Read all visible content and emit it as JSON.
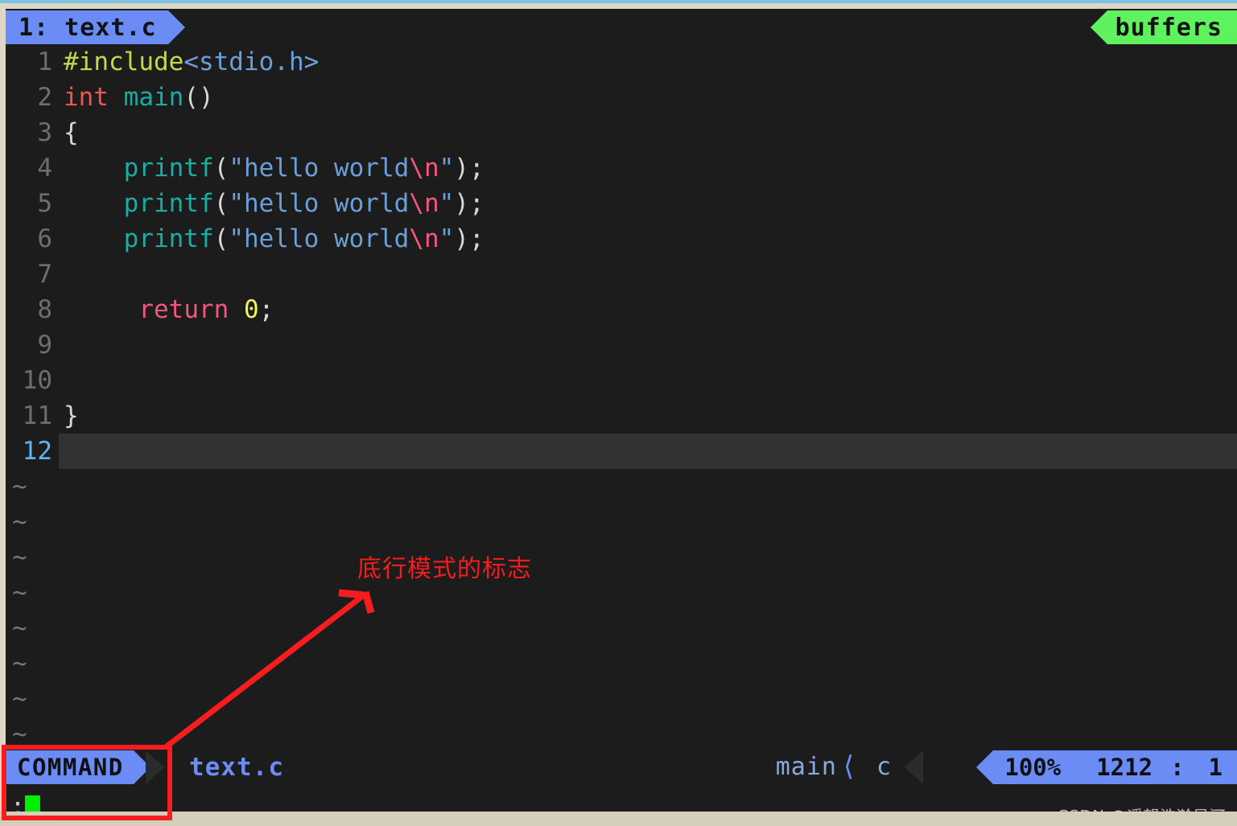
{
  "window": {
    "tabline": {
      "active_tab": "1: text.c",
      "buffers_label": "buffers"
    }
  },
  "editor": {
    "lines": [
      {
        "num": "1",
        "segments": [
          {
            "t": "#include",
            "c": "c-pre"
          },
          {
            "t": "<stdio.h>",
            "c": "c-hdr"
          }
        ]
      },
      {
        "num": "2",
        "segments": [
          {
            "t": "int ",
            "c": "c-type"
          },
          {
            "t": "main",
            "c": "c-fn"
          },
          {
            "t": "()",
            "c": "c-punc"
          }
        ]
      },
      {
        "num": "3",
        "segments": [
          {
            "t": "{",
            "c": "c-plain"
          }
        ]
      },
      {
        "num": "4",
        "segments": [
          {
            "t": "    ",
            "c": "c-plain"
          },
          {
            "t": "printf",
            "c": "c-fn"
          },
          {
            "t": "(",
            "c": "c-punc"
          },
          {
            "t": "\"hello world",
            "c": "c-str"
          },
          {
            "t": "\\n",
            "c": "c-esc"
          },
          {
            "t": "\"",
            "c": "c-str"
          },
          {
            "t": ");",
            "c": "c-punc"
          }
        ]
      },
      {
        "num": "5",
        "segments": [
          {
            "t": "    ",
            "c": "c-plain"
          },
          {
            "t": "printf",
            "c": "c-fn"
          },
          {
            "t": "(",
            "c": "c-punc"
          },
          {
            "t": "\"hello world",
            "c": "c-str"
          },
          {
            "t": "\\n",
            "c": "c-esc"
          },
          {
            "t": "\"",
            "c": "c-str"
          },
          {
            "t": ");",
            "c": "c-punc"
          }
        ]
      },
      {
        "num": "6",
        "segments": [
          {
            "t": "    ",
            "c": "c-plain"
          },
          {
            "t": "printf",
            "c": "c-fn"
          },
          {
            "t": "(",
            "c": "c-punc"
          },
          {
            "t": "\"hello world",
            "c": "c-str"
          },
          {
            "t": "\\n",
            "c": "c-esc"
          },
          {
            "t": "\"",
            "c": "c-str"
          },
          {
            "t": ");",
            "c": "c-punc"
          }
        ]
      },
      {
        "num": "7",
        "segments": [
          {
            "t": "",
            "c": "c-plain"
          }
        ]
      },
      {
        "num": "8",
        "segments": [
          {
            "t": "     ",
            "c": "c-plain"
          },
          {
            "t": "return ",
            "c": "c-kw"
          },
          {
            "t": "0",
            "c": "c-num"
          },
          {
            "t": ";",
            "c": "c-punc"
          }
        ]
      },
      {
        "num": "9",
        "segments": [
          {
            "t": "",
            "c": "c-plain"
          }
        ]
      },
      {
        "num": "10",
        "segments": [
          {
            "t": "",
            "c": "c-plain"
          }
        ]
      },
      {
        "num": "11",
        "segments": [
          {
            "t": "}",
            "c": "c-plain"
          }
        ]
      },
      {
        "num": "12",
        "segments": [
          {
            "t": "",
            "c": "c-plain"
          }
        ],
        "current": true
      }
    ],
    "filler_marker": "~",
    "filler_count": 8
  },
  "statusline": {
    "mode": "COMMAND",
    "filename": "text.c",
    "function": "main",
    "separator_icon": "chevron-left-icon",
    "filetype": "c",
    "percent": "100%",
    "line": "1212",
    "colon": ":",
    "column": "1"
  },
  "commandline": {
    "prompt": ":",
    "input_value": "",
    "cursor": "block-cursor"
  },
  "annotations": {
    "label": "底行模式的标志",
    "box_name": "command-mode-highlight-box",
    "arrow_name": "pointer-arrow",
    "color": "#f51d1d"
  },
  "watermark": {
    "text": "CSDN @遥望浩瀚星河"
  },
  "colors": {
    "background": "#1c1c1c",
    "current_line": "#323232",
    "accent_blue": "#6c8cf5",
    "accent_green": "#5ff25f",
    "cursor_green": "#00ef00",
    "frame": "#ddd7c6"
  }
}
